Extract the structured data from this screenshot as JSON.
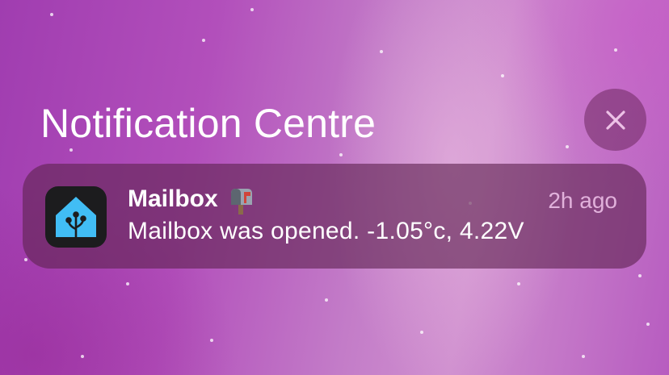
{
  "header": {
    "title": "Notification Centre",
    "close_icon": "close-icon"
  },
  "notification": {
    "app_icon": "home-assistant-icon",
    "title": "Mailbox",
    "title_emoji": "mailbox-emoji",
    "time": "2h ago",
    "body": "Mailbox was opened. -1.05°c, 4.22V"
  },
  "colors": {
    "accent_icon": "#41BDF5",
    "card_bg": "#5F2350",
    "time_text": "#EBBEE6"
  }
}
